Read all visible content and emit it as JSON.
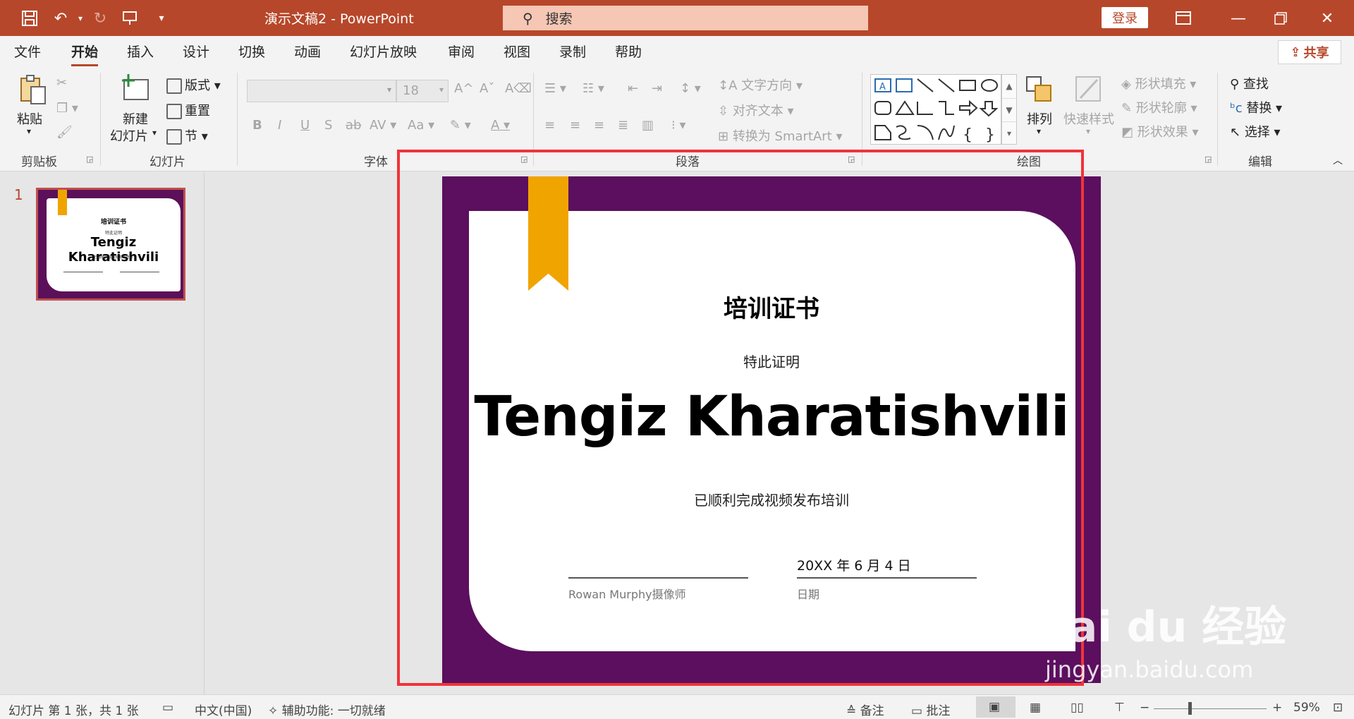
{
  "app": {
    "document_title": "演示文稿2  -  PowerPoint",
    "search_placeholder": "搜索",
    "login_label": "登录",
    "share_label": "共享",
    "accent_color": "#b7472a"
  },
  "tabs": [
    "文件",
    "开始",
    "插入",
    "设计",
    "切换",
    "动画",
    "幻灯片放映",
    "审阅",
    "视图",
    "录制",
    "帮助"
  ],
  "active_tab": "开始",
  "ribbon": {
    "clipboard": {
      "paste": "粘贴",
      "group_label": "剪贴板"
    },
    "slides": {
      "new_slide_line1": "新建",
      "new_slide_line2": "幻灯片",
      "layout": "版式",
      "reset": "重置",
      "section": "节",
      "group_label": "幻灯片"
    },
    "font": {
      "size": "18",
      "group_label": "字体"
    },
    "paragraph": {
      "text_direction": "文字方向",
      "align_text": "对齐文本",
      "smartart": "转换为 SmartArt",
      "group_label": "段落"
    },
    "drawing": {
      "arrange": "排列",
      "quick_styles": "快速样式",
      "shape_fill": "形状填充",
      "shape_outline": "形状轮廓",
      "shape_effects": "形状效果",
      "group_label": "绘图"
    },
    "editing": {
      "find": "查找",
      "replace": "替换",
      "select": "选择",
      "group_label": "编辑"
    }
  },
  "thumbnail": {
    "number": "1"
  },
  "slide": {
    "title": "培训证书",
    "subtitle": "特此证明",
    "name": "Tengiz Kharatishvili",
    "description": "已顺利完成视频发布培训",
    "signer": "Rowan Murphy摄像师",
    "date_value": "20XX 年 6 月 4 日",
    "date_label": "日期",
    "background_color": "#5b0f5e",
    "ribbon_color": "#f0a400"
  },
  "statusbar": {
    "slide_info": "幻灯片 第 1 张，共 1 张",
    "language": "中文(中国)",
    "accessibility": "辅助功能: 一切就绪",
    "notes": "备注",
    "comments": "批注",
    "zoom": "59%"
  },
  "watermark": {
    "brand": "Bai du 经验",
    "url": "jingyan.baidu.com"
  }
}
